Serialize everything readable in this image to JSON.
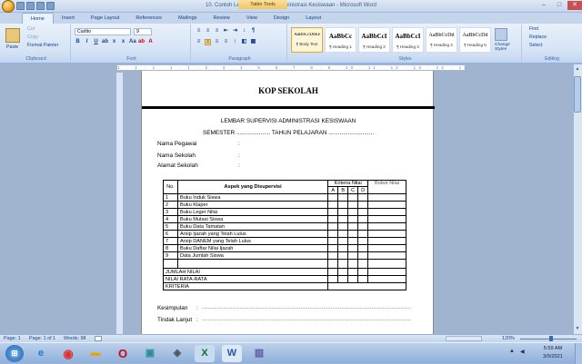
{
  "titlebar": {
    "title": "10. Contoh Lembar Supervisi Administrasi Kesiswaan - Microsoft Word",
    "table_tools": "Table Tools",
    "minimize": "–",
    "maximize": "□",
    "close": "✕"
  },
  "tabs": [
    "Home",
    "Insert",
    "Page Layout",
    "References",
    "Mailings",
    "Review",
    "View",
    "Design",
    "Layout"
  ],
  "clipboard": {
    "paste": "Paste",
    "cut": "Cut",
    "copy": "Copy",
    "format_painter": "Format Painter",
    "label": "Clipboard"
  },
  "font": {
    "name": "Carlito",
    "size": "9",
    "label": "Font"
  },
  "paragraph": {
    "label": "Paragraph"
  },
  "styles": {
    "label": "Styles",
    "change": "Change Styles",
    "items": [
      {
        "preview": "AaBbCcDdEe",
        "name": "¶ Body Text"
      },
      {
        "preview": "AaBbCc",
        "name": "¶ Heading 1"
      },
      {
        "preview": "AaBbCcI",
        "name": "¶ Heading 2"
      },
      {
        "preview": "AaBbCcI",
        "name": "¶ Heading 3"
      },
      {
        "preview": "AaBbCcDd",
        "name": "¶ Heading 4"
      },
      {
        "preview": "AaBbCcDd",
        "name": "¶ Heading 5"
      }
    ]
  },
  "editing": {
    "find": "Find",
    "replace": "Replace",
    "select": "Select",
    "label": "Editing"
  },
  "ruler": "1 · 2 · 1 · 1 · 1 · 2 · 3 · 4 · 5 · 6 · 7 · 8 · 9 · 10 · 11 · 12 · 13 · 14 · 15 · 16 · 17",
  "document": {
    "kop": "KOP SEKOLAH",
    "title": "LEMBAR SUPERVISI ADMINISTRASI KESISWAAN",
    "semester": "SEMESTER ..................... TAHUN PELAJARAN ............................",
    "fields": [
      {
        "label": "Nama Pegawai",
        "colon": ":"
      },
      {
        "label": "Nama Sekolah",
        "colon": ":"
      },
      {
        "label": "Alamat Sekolah",
        "colon": ":"
      }
    ],
    "table": {
      "h_no": "No.",
      "h_aspek": "Aspek yang Disupervisi",
      "h_kriteria": "Kriteria Nilai",
      "h_bobot": "Bobot Nilai",
      "crit": [
        "A",
        "B",
        "C",
        "D"
      ],
      "rows": [
        {
          "no": "1",
          "aspek": "Buku Induk Siswa"
        },
        {
          "no": "2",
          "aspek": "Buku Klaper"
        },
        {
          "no": "3",
          "aspek": "Buku Leger Nilai"
        },
        {
          "no": "4",
          "aspek": "Buku Mutasi Siswa"
        },
        {
          "no": "5",
          "aspek": "Buku Data  Tamatan"
        },
        {
          "no": "6",
          "aspek": "Arsip Ijazah yang  Telah Lulus"
        },
        {
          "no": "7",
          "aspek": "Arsip DANEM  yang Telah Lulus"
        },
        {
          "no": "8",
          "aspek": "Buku Daftar Nilai  Ijazah"
        },
        {
          "no": "9",
          "aspek": "Data Jumlah Siswa"
        }
      ],
      "jumlah": "JUMLAH NILAI",
      "rata": "NILAI RATA-RATA",
      "kriteria": "KRITERIA"
    },
    "kesimpulan": "Kesimpulan",
    "tindak": "Tindak  Lanjut",
    "dotline": "........................................................................................................................................................................"
  },
  "status": {
    "page": "Page: 1",
    "page_of": "Page: 1 of 1",
    "words": "Words: 98",
    "zoom": "120%"
  },
  "taskbar": {
    "time": "5:59 AM",
    "date": "3/9/2021"
  }
}
